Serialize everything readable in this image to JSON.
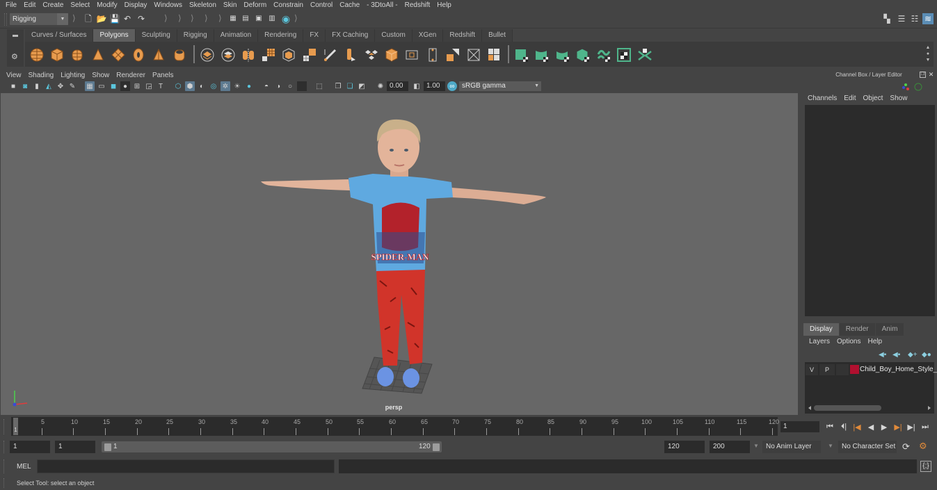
{
  "menubar": {
    "items": [
      "File",
      "Edit",
      "Create",
      "Select",
      "Modify",
      "Display",
      "Windows",
      "Skeleton",
      "Skin",
      "Deform",
      "Constrain",
      "Control",
      "Cache",
      "- 3DtoAll -",
      "Redshift",
      "Help"
    ]
  },
  "statusline": {
    "mode": "Rigging",
    "icons": [
      "new-scene-icon",
      "open-scene-icon",
      "save-scene-icon",
      "undo-icon",
      "redo-icon",
      "render-view-icon",
      "render-frame-icon",
      "ipr-render-icon",
      "render-settings-icon",
      "hypershade-icon"
    ],
    "right_icons": [
      "modeling-toolkit-icon",
      "attribute-editor-icon",
      "tool-settings-icon",
      "channel-box-icon"
    ]
  },
  "shelf": {
    "tabs": [
      "Curves / Surfaces",
      "Polygons",
      "Sculpting",
      "Rigging",
      "Animation",
      "Rendering",
      "FX",
      "FX Caching",
      "Custom",
      "XGen",
      "Redshift",
      "Bullet"
    ],
    "active_tab": "Polygons",
    "orange_icons": [
      "poly-sphere-icon",
      "poly-cube-icon",
      "poly-cylinder-icon",
      "poly-cone-icon",
      "poly-plane-icon",
      "poly-torus-icon",
      "poly-pyramid-icon",
      "poly-pipe-icon"
    ],
    "tool_icons": [
      "combine-icon",
      "separate-icon",
      "mirror-icon",
      "smooth-icon",
      "extrude-icon",
      "bridge-icon",
      "insert-edge-loop-icon",
      "multi-cut-icon",
      "bevel-icon",
      "target-weld-icon",
      "bevel-face-icon",
      "collapse-icon",
      "connect-icon",
      "fill-hole-icon",
      "merge-icon",
      "reduce-icon"
    ],
    "uv_icons": [
      "planar-uv-icon",
      "cylindrical-uv-icon",
      "spherical-uv-icon",
      "automatic-uv-icon",
      "unfold-uv-icon",
      "uv-editor-icon",
      "uv-layout-icon"
    ]
  },
  "viewport": {
    "menu": [
      "View",
      "Shading",
      "Lighting",
      "Show",
      "Renderer",
      "Panels"
    ],
    "exposure": "0.00",
    "gamma": "1.00",
    "color_space": "sRGB gamma",
    "camera_label": "persp"
  },
  "channel_box": {
    "title": "Channel Box / Layer Editor",
    "menu": [
      "Channels",
      "Edit",
      "Object",
      "Show"
    ]
  },
  "layer_editor": {
    "tabs": [
      "Display",
      "Render",
      "Anim"
    ],
    "active_tab": "Display",
    "menu": [
      "Layers",
      "Options",
      "Help"
    ],
    "layers": [
      {
        "visible": "V",
        "playback": "P",
        "color": "#b0102f",
        "name": "Child_Boy_Home_Style_T"
      }
    ]
  },
  "timeline": {
    "ticks": [
      "5",
      "10",
      "15",
      "20",
      "25",
      "30",
      "35",
      "40",
      "45",
      "50",
      "55",
      "60",
      "65",
      "70",
      "75",
      "80",
      "85",
      "90",
      "95",
      "100",
      "105",
      "110",
      "115",
      "120"
    ],
    "start_tick": "1",
    "current_frame": "1"
  },
  "range": {
    "start_time": "1",
    "playback_start": "1",
    "range_start_label": "1",
    "range_end_label": "120",
    "playback_end": "120",
    "end_time": "200",
    "anim_layer": "No Anim Layer",
    "character_set": "No Character Set"
  },
  "command_line": {
    "label": "MEL",
    "input": "",
    "output": ""
  },
  "help_line": "Select Tool: select an object"
}
